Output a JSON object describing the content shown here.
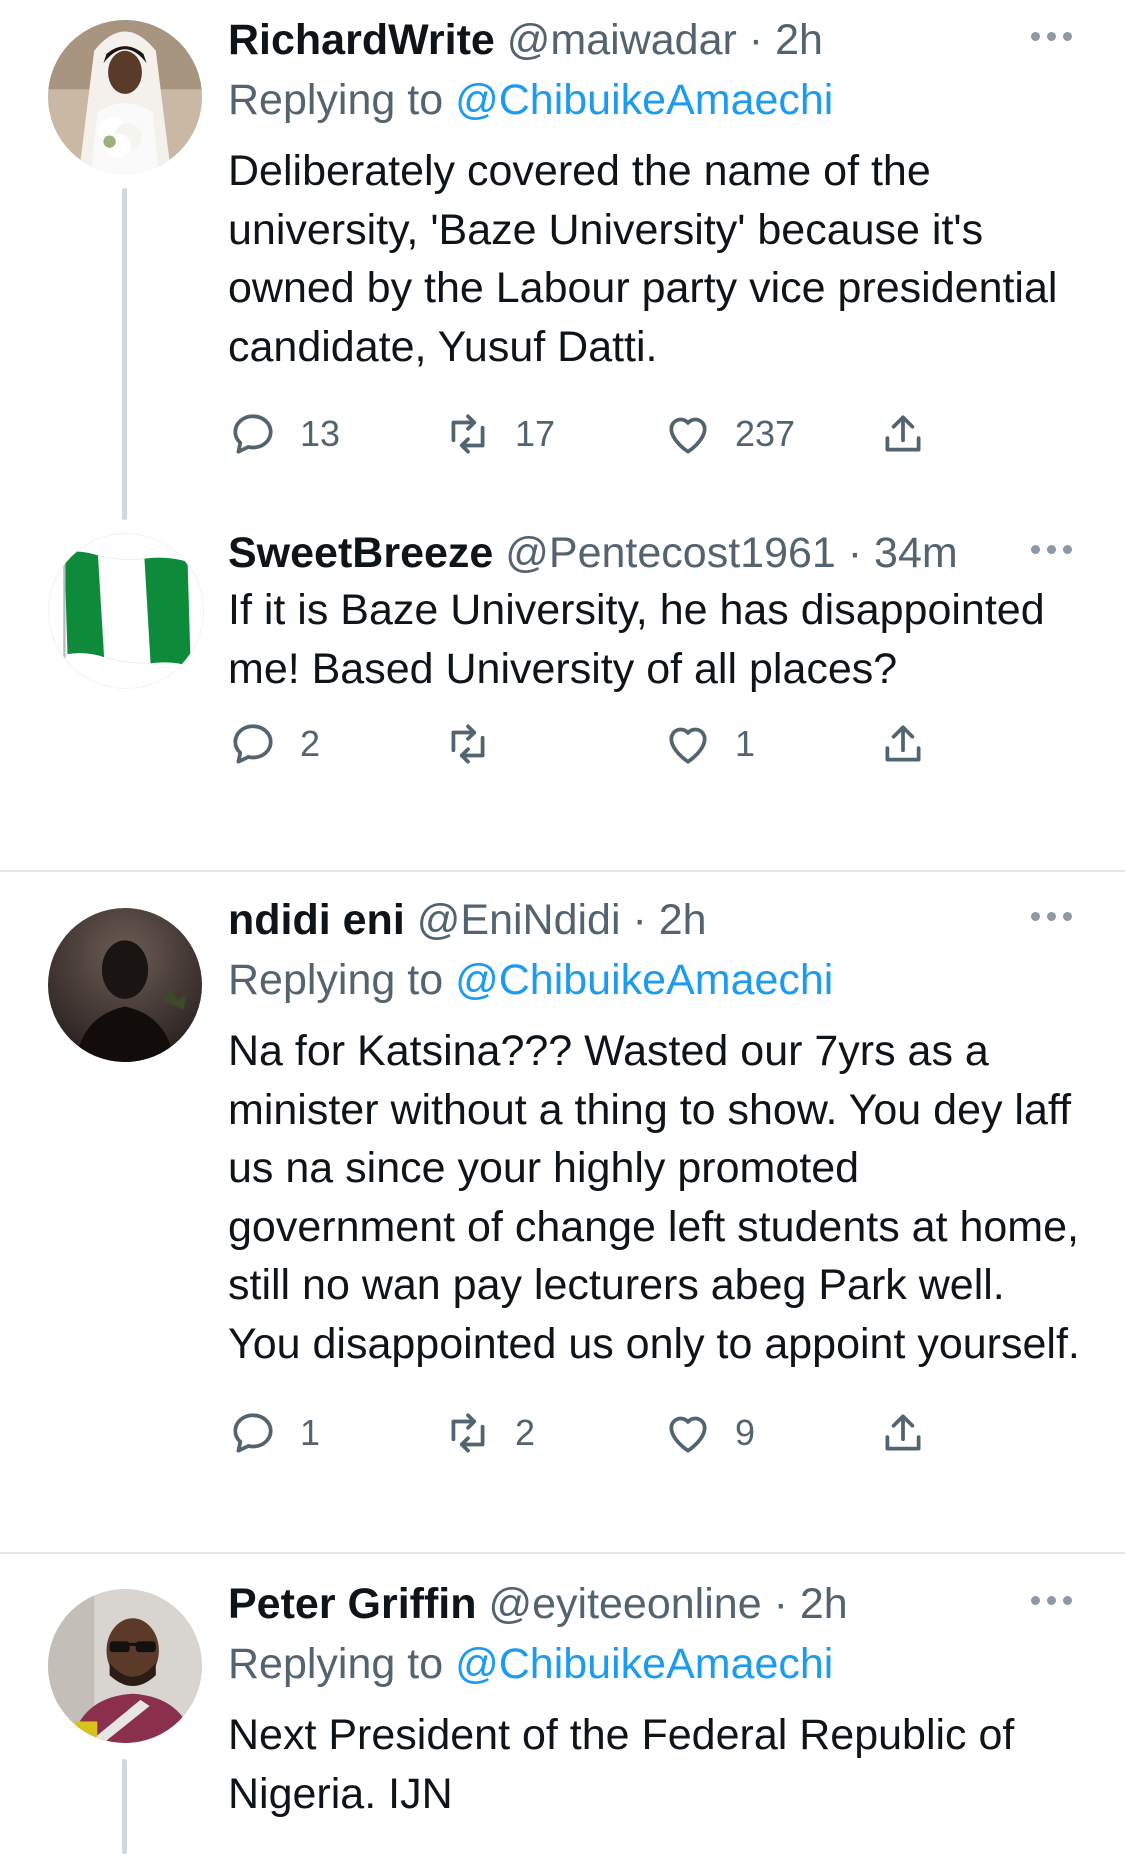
{
  "tweets": [
    {
      "name": "RichardWrite",
      "handle": "@maiwadar",
      "dot": "·",
      "time": "2h",
      "replying_label": "Replying to",
      "replying_to": "@ChibuikeAmaechi",
      "text": "Deliberately covered the name of the university, 'Baze University' because it's owned by the Labour party vice presidential candidate, Yusuf Datti.",
      "replies": "13",
      "retweets": "17",
      "likes": "237",
      "avatar_icon": "bride-photo-avatar"
    },
    {
      "name": "SweetBreeze",
      "handle": "@Pentecost1961",
      "dot": "·",
      "time": "34m",
      "text": "If it is Baze University, he has disappointed me! Based University of all places?",
      "replies": "2",
      "retweets": "",
      "likes": "1",
      "avatar_icon": "nigeria-flag-avatar"
    },
    {
      "name": "ndidi eni",
      "handle": "@EniNdidi",
      "dot": "·",
      "time": "2h",
      "replying_label": "Replying to",
      "replying_to": "@ChibuikeAmaechi",
      "text": "Na for Katsina??? Wasted our 7yrs as a minister without a thing to show. You dey laff us na since your highly promoted government of change left students at home, still no wan pay lecturers abeg Park well. You disappointed us only to appoint yourself.",
      "replies": "1",
      "retweets": "2",
      "likes": "9",
      "avatar_icon": "silhouette-photo-avatar"
    },
    {
      "name": "Peter Griffin",
      "handle": "@eyiteeonline",
      "dot": "·",
      "time": "2h",
      "replying_label": "Replying to",
      "replying_to": "@ChibuikeAmaechi",
      "text": "Next President of the Federal Republic of Nigeria. IJN",
      "avatar_icon": "man-sunglasses-photo-avatar"
    }
  ],
  "colors": {
    "text": "#0f1419",
    "secondary": "#536471",
    "link": "#1d9bf0",
    "divider": "#e1e8ed",
    "thread_line": "#cfd9de"
  }
}
